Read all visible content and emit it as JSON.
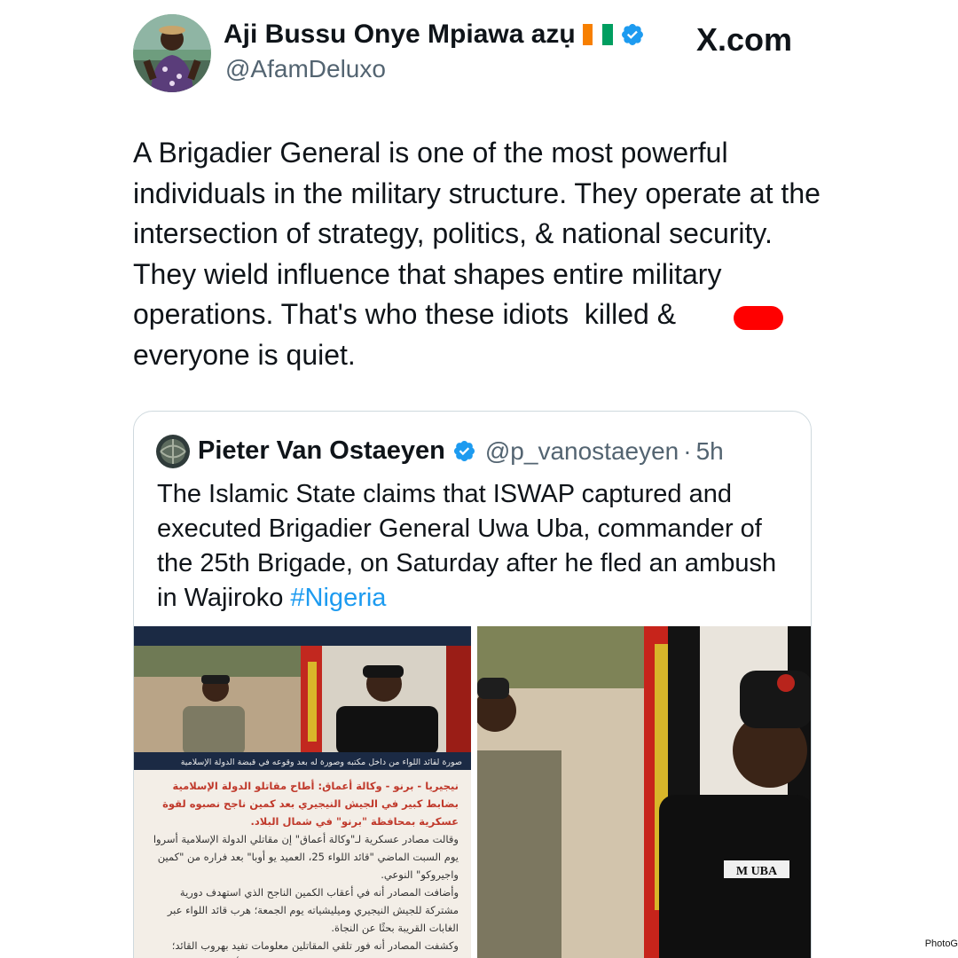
{
  "author": {
    "display_name": "Aji Bussu Onye Mpiawa azụ",
    "handle": "@AfamDeluxo",
    "flag_colors": [
      "#f77f00",
      "#ffffff",
      "#009e60"
    ],
    "verified_icon": "verified-badge-icon"
  },
  "site_logo": "X.com",
  "tweet": {
    "text": "A Brigadier General is one of the most powerful individuals in the military structure. They operate at the intersection of strategy, politics, & national security. They wield influence that shapes entire military operations. That's who these idiots  killed &\neveryone is quiet."
  },
  "quoted_tweet": {
    "author_name": "Pieter Van Ostaeyen",
    "handle": "@p_vanostaeyen",
    "separator": "·",
    "time": "5h",
    "text": "The Islamic State claims that ISWAP captured and executed Brigadier General Uwa Uba, commander of the 25th Brigade, on Saturday after he fled an ambush in Wajiroko ",
    "hashtag": "#Nigeria",
    "media": {
      "left_caption": "صورة لقائد اللواء من داخل مكتبه وصورة له بعد وقوعه في قبضة الدولة الإسلامية",
      "left_article": [
        "نيجيريا - برنو - وكالة أعماق: أطاح مقاتلو الدولة الإسلامية بضابط كبير في الجيش النيجيري بعد كمين ناجح نصبوه لقوة عسكرية بمحافظة \"برنو\" في شمال البلاد.",
        "وقالت مصادر عسكرية لـ\"وكالة أعماق\" إن مقاتلي الدولة الإسلامية أسروا يوم السبت الماضي \"قائد اللواء 25، العميد يو أوبا\" بعد فراره من \"كمين واجيروكو\" النوعي.",
        "وأضافت المصادر أنه في أعقاب الكمين الناجح الذي استهدف دورية مشتركة للجيش النيجيري وميليشياته يوم الجمعة؛ هرب قائد اللواء عبر الغابات القريبة بحثًا عن النجاة.",
        "وكشفت المصادر أنه فور تلقي المقاتلين معلومات تفيد بهروب القائد؛ انطلقت وحدة من المقاتلين للبحث عنه، ونجحت في أسره نهار السبت."
      ],
      "right_name_tag": "M UBA"
    }
  },
  "watermark": "PhotoG"
}
